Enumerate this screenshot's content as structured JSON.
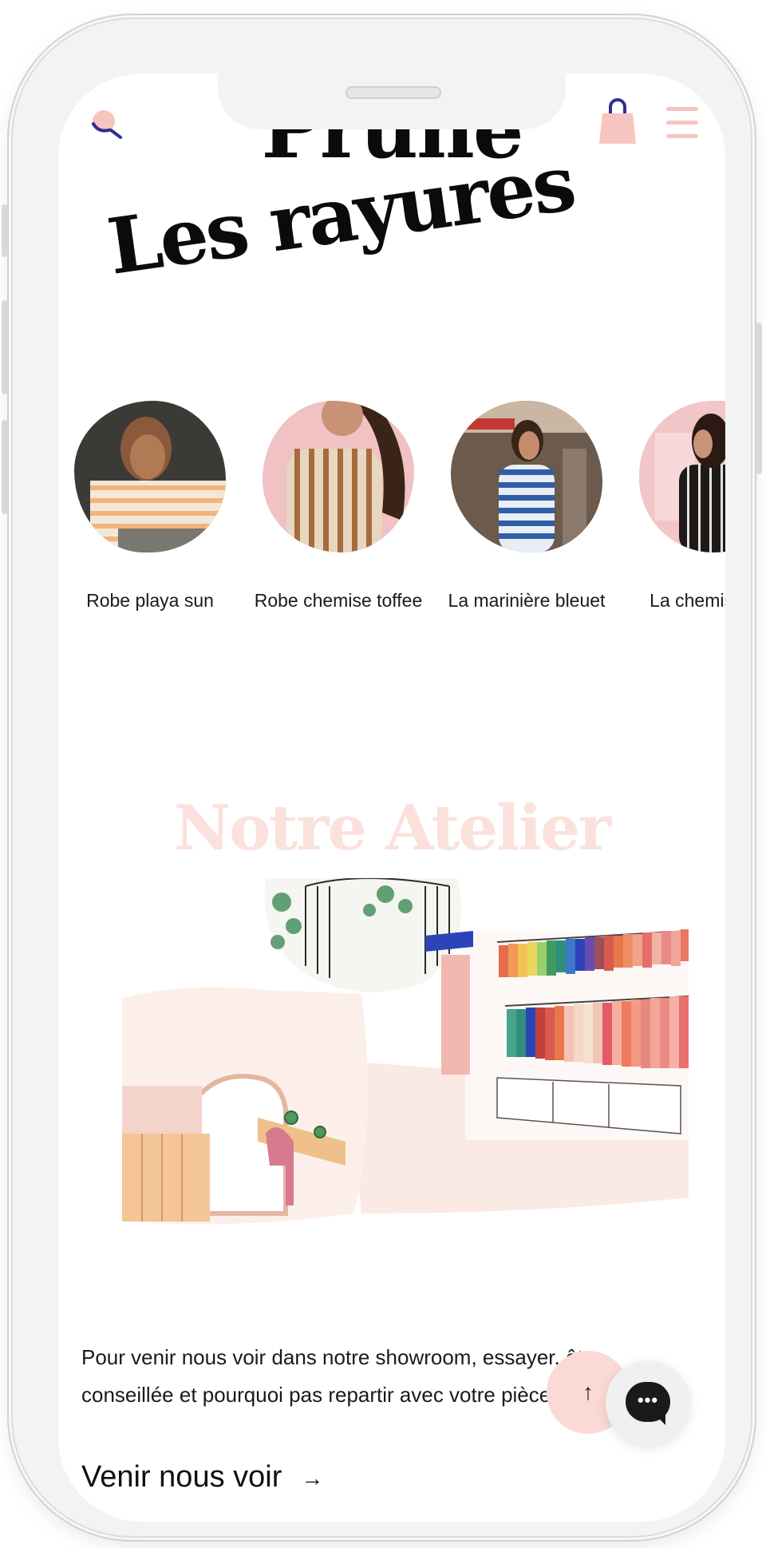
{
  "header": {
    "brand": "Prune",
    "icons": {
      "search": "search-icon",
      "bag": "shopping-bag-icon",
      "menu": "menu-icon"
    }
  },
  "collection": {
    "title": "Les rayures",
    "products": [
      {
        "name": "Robe playa sun"
      },
      {
        "name": "Robe chemise toffee"
      },
      {
        "name": "La marinière bleuet"
      },
      {
        "name": "La chemise rafa"
      }
    ]
  },
  "atelier": {
    "title": "Notre Atelier",
    "text": "Pour venir nous voir dans notre showroom, essayer, être conseillée et pourquoi pas repartir avec votre pièce préférée :)",
    "link_label": "Venir nous voir",
    "link_arrow": "→"
  },
  "floating": {
    "scroll_top": "↑",
    "chat_dots": "•••"
  },
  "colors": {
    "accent_pink": "#f7c5bf",
    "atelier_title": "#fbe1dc",
    "search_blue": "#2c2f8f",
    "text": "#1a1a1a"
  }
}
